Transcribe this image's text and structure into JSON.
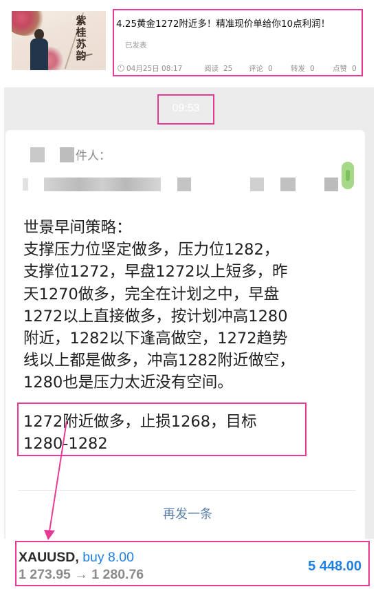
{
  "article": {
    "title": "4.25黄金1272附近多！精准现价单给你10点利润！",
    "status": "已发表",
    "datetime": "04月25日 08:17",
    "stats": [
      {
        "label": "阅读",
        "value": "25"
      },
      {
        "label": "评论",
        "value": "0"
      },
      {
        "label": "转发",
        "value": "0"
      },
      {
        "label": "点赞",
        "value": "0"
      }
    ],
    "thumbnail": {
      "calligraphy": [
        "紫",
        "桂",
        "苏",
        "韵"
      ]
    }
  },
  "chat": {
    "time": "09:53",
    "sender_label": "件人：",
    "message_lines": [
      "世景早间策略：",
      "支撑压力位坚定做多，压力位1282，",
      "支撑位1272，早盘1272以上短多，昨",
      "天1270做多，完全在计划之中，早盘",
      "1272以上直接做多，按计划冲高1280",
      "附近，1282以下逢高做空，1272趋势",
      "线以上都是做多，冲高1282附近做空，",
      "1280也是压力太近没有空间。"
    ],
    "highlight_lines": [
      "1272附近做多，止损1268，目标",
      "1280-1282"
    ],
    "resend_label": "再发一条"
  },
  "trade": {
    "symbol": "XAUUSD,",
    "side": "buy 8.00",
    "prices": "1 273.95 → 1 280.76",
    "profit": "5 448.00"
  },
  "colors": {
    "highlight_border": "#e83a94",
    "trade_blue": "#1f7fe0",
    "link_blue": "#5a7ea8"
  }
}
